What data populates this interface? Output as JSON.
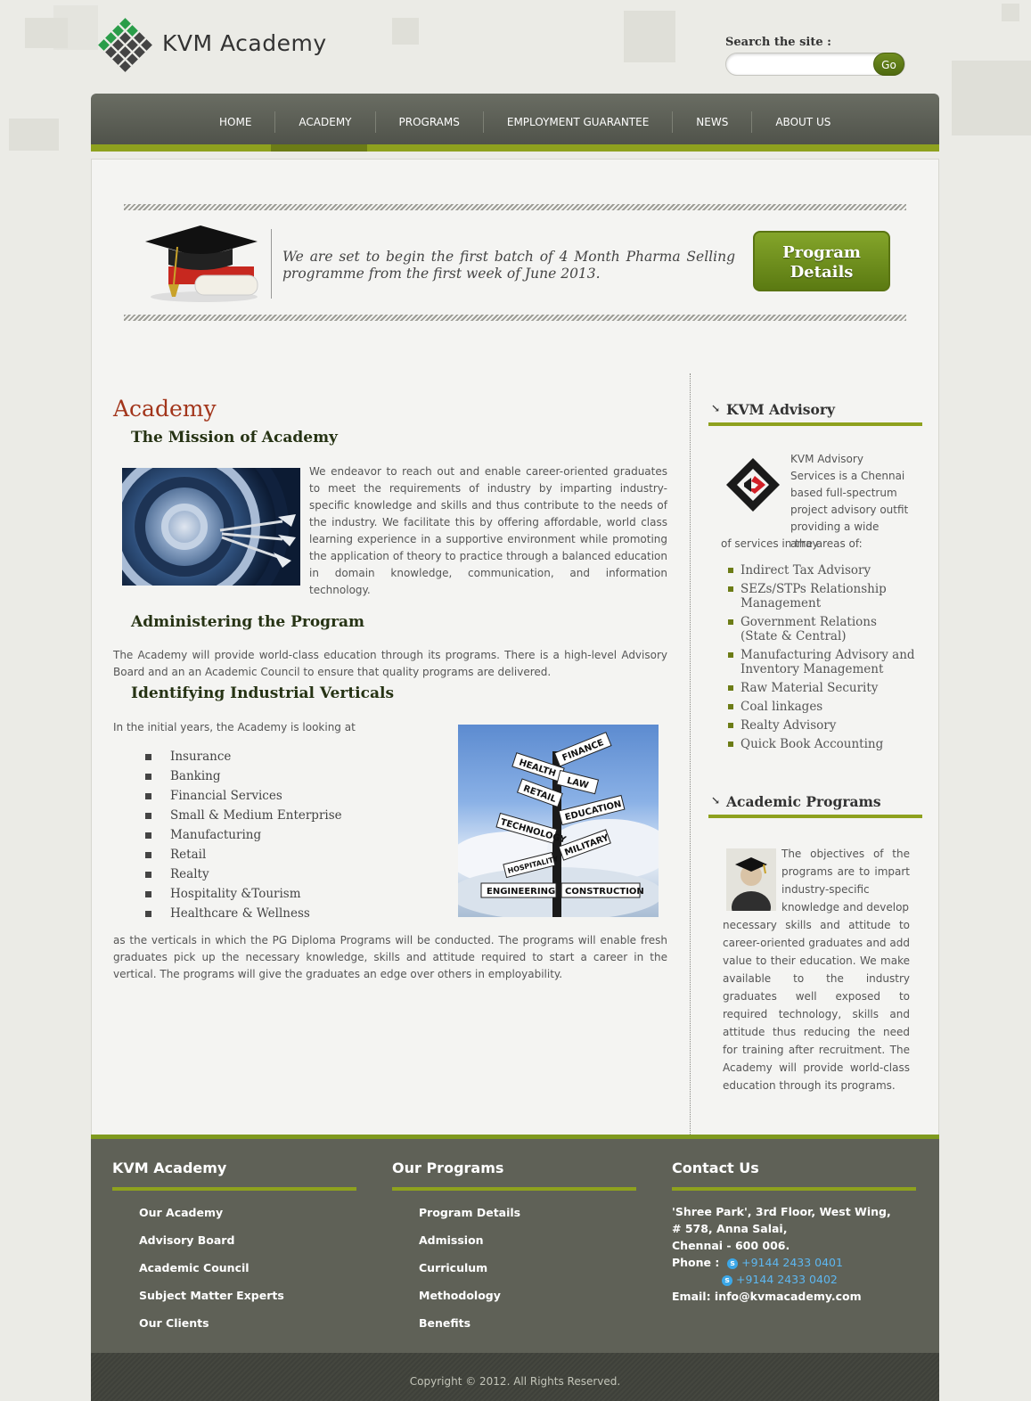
{
  "header": {
    "brand": "KVM Academy",
    "search_label": "Search the site :",
    "search_placeholder": "",
    "go_label": "Go"
  },
  "nav": {
    "items": [
      "HOME",
      "ACADEMY",
      "PROGRAMS",
      "EMPLOYMENT GUARANTEE",
      "NEWS",
      "ABOUT US"
    ],
    "active": "ACADEMY"
  },
  "banner": {
    "text": "We are set to begin the first batch of 4 Month Pharma Selling programme from the first week of June 2013.",
    "button_label_1": "Program",
    "button_label_2": "Details"
  },
  "content": {
    "title": "Academy",
    "mission_heading": "The Mission of Academy",
    "mission_text": "We endeavor to reach out and enable career-oriented graduates to meet the requirements of industry by imparting industry-specific knowledge and skills and thus contribute to the needs of the industry. We facilitate this by offering affordable, world class learning experience in a supportive environment while promoting the application of theory to practice through a balanced education in domain knowledge, communication, and information technology.",
    "admin_heading": "Administering the Program",
    "admin_text": "The Academy will provide world-class education through its programs. There is a high-level Advisory Board and an an Academic Council to ensure that quality programs are delivered.",
    "verticals_heading": "Identifying Industrial Verticals",
    "verticals_intro": "In the initial years, the Academy is looking at",
    "verticals": [
      "Insurance",
      "Banking",
      "Financial Services",
      "Small & Medium Enterprise",
      "Manufacturing",
      "Retail",
      "Realty",
      "Hospitality &Tourism",
      "Healthcare & Wellness"
    ],
    "verticals_outro": "as the verticals in which the PG Diploma Programs will be conducted. The programs will enable fresh graduates pick up the necessary knowledge, skills and attitude required to start a career in the vertical. The programs will give the graduates an edge over others in employability.",
    "signpost_labels": [
      "FINANCE",
      "HEALTH",
      "LAW",
      "RETAIL",
      "EDUCATION",
      "TECHNOLOGY",
      "MILITARY",
      "HOSPITALITY",
      "ENGINEERING",
      "CONSTRUCTION"
    ]
  },
  "sidebar": {
    "advisory_heading": "KVM Advisory",
    "advisory_text_1": "KVM Advisory Services is a Chennai based full-spectrum project advisory outfit providing a wide array",
    "advisory_text_2": "of services in the areas of:",
    "services": [
      "Indirect Tax Advisory",
      "SEZs/STPs Relationship Management",
      "Government Relations (State & Central)",
      "Manufacturing Advisory and Inventory Management",
      "Raw Material Security",
      "Coal linkages",
      "Realty Advisory",
      "Quick Book Accounting"
    ],
    "programs_heading": "Academic Programs",
    "programs_text_1": "The objectives of the programs are to impart industry-specific knowledge and develop",
    "programs_text_2": "necessary skills and attitude to career-oriented graduates and add value to their education. We make available to the industry graduates well exposed to required technology, skills and attitude thus reducing the need for training after recruitment. The Academy will provide world-class education through its programs."
  },
  "footer": {
    "col1_heading": "KVM Academy",
    "col1_links": [
      "Our Academy",
      "Advisory Board",
      "Academic Council",
      "Subject Matter Experts",
      "Our Clients"
    ],
    "col2_heading": "Our Programs",
    "col2_links": [
      "Program Details",
      "Admission",
      "Curriculum",
      "Methodology",
      "Benefits"
    ],
    "col3_heading": "Contact Us",
    "address_1": "'Shree Park', 3rd Floor, West Wing,",
    "address_2": "# 578, Anna Salai,",
    "address_3": "Chennai - 600 006.",
    "phone_label": "Phone :",
    "phone_1": "+9144 2433 0401",
    "phone_2": "+9144 2433 0402",
    "email": "Email: info@kvmacademy.com",
    "copyright": "Copyright © 2012. All Rights Reserved."
  },
  "colors": {
    "accent_green": "#8ea11e",
    "title_red": "#a2351b",
    "nav_dark": "#4c4f47",
    "footer_bg": "#5f6157"
  }
}
